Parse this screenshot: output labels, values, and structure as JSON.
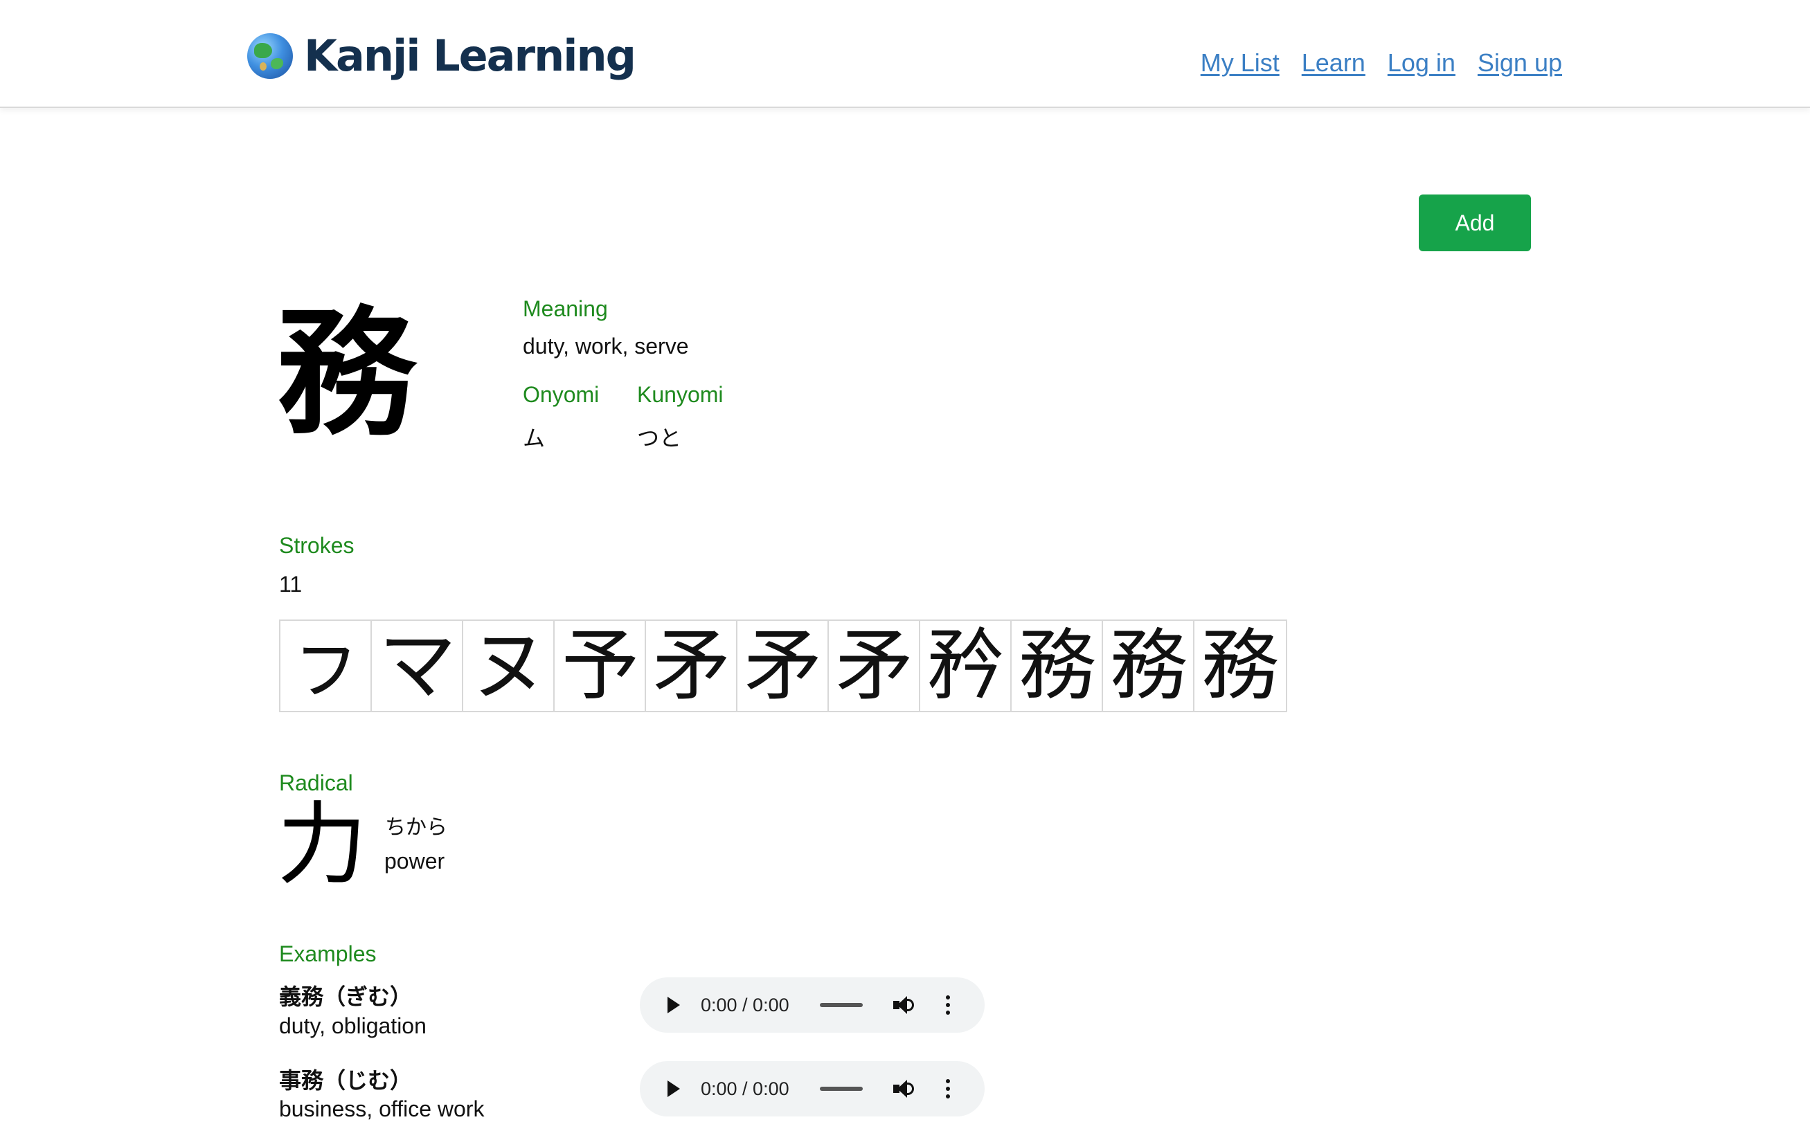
{
  "brand": {
    "name": "Kanji Learning",
    "logo_icon": "globe-icon"
  },
  "nav": {
    "links": [
      "My List",
      "Learn",
      "Log in",
      "Sign up"
    ]
  },
  "actions": {
    "add_label": "Add"
  },
  "kanji": {
    "character": "務",
    "meaning_label": "Meaning",
    "meaning": "duty, work, serve",
    "onyomi_label": "Onyomi",
    "onyomi": "ム",
    "kunyomi_label": "Kunyomi",
    "kunyomi": "つと"
  },
  "strokes": {
    "label": "Strokes",
    "count": "11",
    "steps": [
      "ㇷ",
      "マ",
      "ヌ",
      "予",
      "矛",
      "矛",
      "矛",
      "矜",
      "務",
      "務",
      "務"
    ]
  },
  "radical": {
    "label": "Radical",
    "character": "力",
    "reading": "ちから",
    "meaning": "power"
  },
  "examples": {
    "label": "Examples",
    "items": [
      {
        "word": "義務（ぎむ）",
        "meaning": "duty, obligation",
        "audio_time": "0:00 / 0:00"
      },
      {
        "word": "事務（じむ）",
        "meaning": "business, office work",
        "audio_time": "0:00 / 0:00"
      }
    ]
  },
  "colors": {
    "label": "#1e8a1e",
    "link": "#3b7fc4",
    "brand": "#14304e",
    "add_button": "#16a34a"
  }
}
